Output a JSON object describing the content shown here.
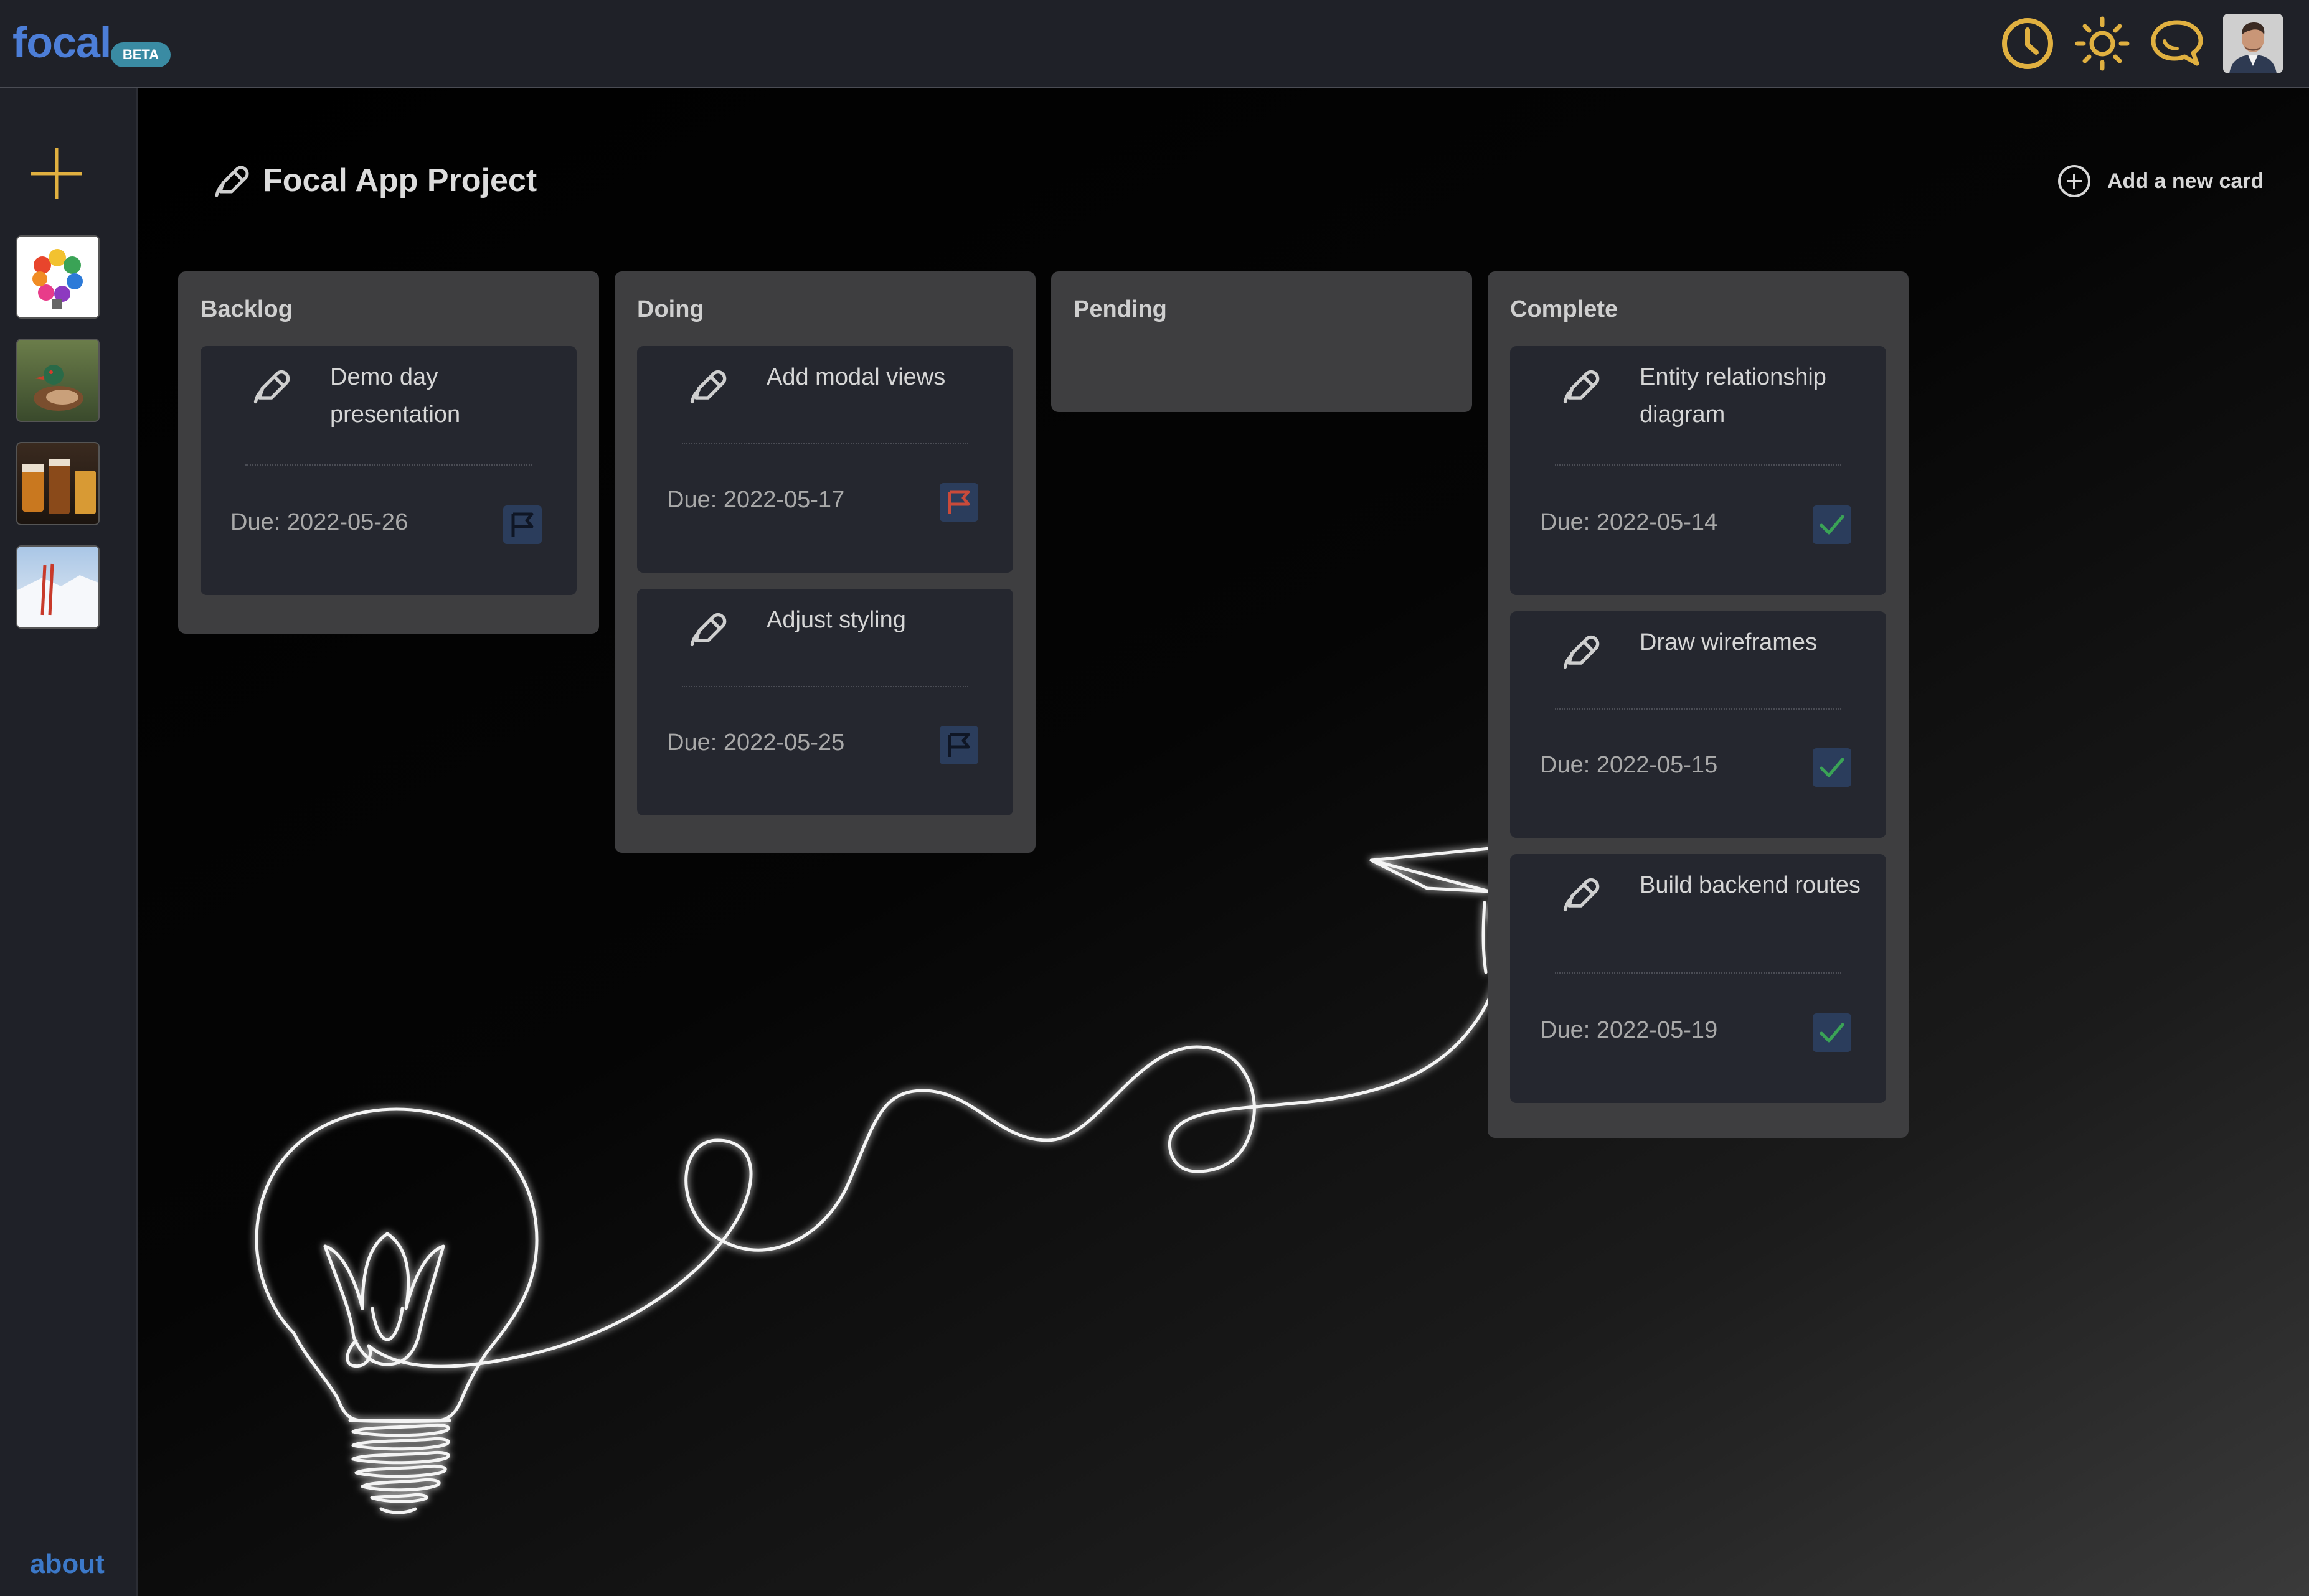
{
  "app": {
    "logo": "focal",
    "badge": "BETA",
    "accent_color": "#e0b040",
    "header_icons": [
      "clock-icon",
      "sun-icon",
      "chat-icon",
      "user-avatar"
    ]
  },
  "sidebar": {
    "add_icon": "plus-icon",
    "boards": [
      {
        "name": "board-thumb-colorful"
      },
      {
        "name": "board-thumb-duck"
      },
      {
        "name": "board-thumb-drinks"
      },
      {
        "name": "board-thumb-snow"
      }
    ],
    "about": "about"
  },
  "project": {
    "title": "Focal App Project",
    "add_card": "Add a new card"
  },
  "columns": [
    {
      "title": "Backlog",
      "cards": [
        {
          "title": "Demo day presentation",
          "due": "Due: 2022-05-26",
          "status": "flag",
          "status_color": "#0f1625"
        }
      ]
    },
    {
      "title": "Doing",
      "cards": [
        {
          "title": "Add modal views",
          "due": "Due: 2022-05-17",
          "status": "flag",
          "status_color": "#c94a3a"
        },
        {
          "title": "Adjust styling",
          "due": "Due: 2022-05-25",
          "status": "flag",
          "status_color": "#0f1625"
        }
      ]
    },
    {
      "title": "Pending",
      "cards": []
    },
    {
      "title": "Complete",
      "cards": [
        {
          "title": "Entity relationship diagram",
          "due": "Due: 2022-05-14",
          "status": "check",
          "status_color": "#3aa356"
        },
        {
          "title": "Draw wireframes",
          "due": "Due: 2022-05-15",
          "status": "check",
          "status_color": "#3aa356"
        },
        {
          "title": "Build backend routes",
          "due": "Due: 2022-05-19",
          "status": "check",
          "status_color": "#3aa356"
        }
      ]
    }
  ]
}
